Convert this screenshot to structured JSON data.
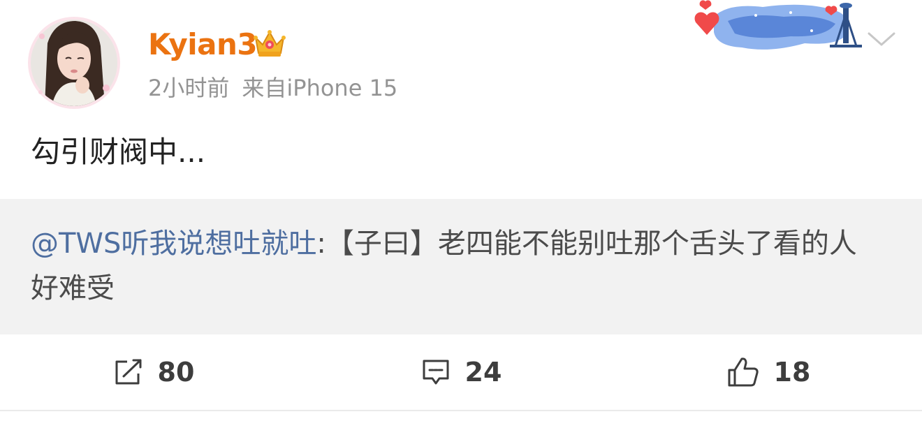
{
  "post": {
    "author": {
      "name": "Kyian3",
      "avatar_icon": "avatar-photo",
      "vip_icon": "crown-icon"
    },
    "meta": {
      "time": "2小时前",
      "source": "来自iPhone 15"
    },
    "text": "勾引财阀中...",
    "repost": {
      "mention": "@TWS听我说想吐就吐",
      "separator": ":",
      "content": "【子曰】老四能不能别吐那个舌头了看的人好难受"
    },
    "actions": {
      "repost_count": "80",
      "comment_count": "24",
      "like_count": "18",
      "repost_icon": "share-icon",
      "comment_icon": "comment-icon",
      "like_icon": "thumbs-up-icon"
    }
  },
  "colors": {
    "username": "#eb7311",
    "mention": "#4e6ea0",
    "meta": "#939393",
    "repost_bg": "#f2f2f2"
  }
}
